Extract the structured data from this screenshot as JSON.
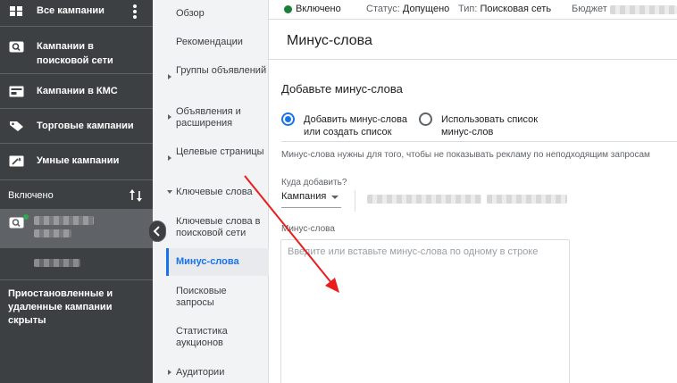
{
  "sidebar": {
    "all_campaigns": "Все кампании",
    "search_campaigns": "Кампании в поисковой сети",
    "display_campaigns": "Кампании в КМС",
    "shopping_campaigns": "Торговые кампании",
    "smart_campaigns": "Умные кампании",
    "enabled_section": "Включено",
    "hidden_note": "Приостановленные и удаленные кампании скрыты"
  },
  "nav": {
    "overview": "Обзор",
    "recommendations": "Рекомендации",
    "ad_groups": "Группы объявлений",
    "ads_extensions": "Объявления и расширения",
    "landing_pages": "Целевые страницы",
    "keywords": "Ключевые слова",
    "search_keywords": "Ключевые слова в поисковой сети",
    "negative_keywords": "Минус-слова",
    "search_terms": "Поисковые запросы",
    "auction_insights": "Статистика аукционов",
    "audiences": "Аудитории"
  },
  "topbar": {
    "enabled": "Включено",
    "status_label": "Статус:",
    "status_value": "Допущено",
    "type_label": "Тип:",
    "type_value": "Поисковая сеть",
    "budget_label": "Бюджет"
  },
  "main": {
    "title": "Минус-слова",
    "section_title": "Добавьте минус-слова",
    "option_add": "Добавить минус-слова или создать список",
    "option_use_list": "Использовать список минус-слов",
    "hint": "Минус-слова нужны для того, чтобы не показывать рекламу по неподходящим запросам",
    "where_label": "Куда добавить?",
    "where_value": "Кампания",
    "neg_label": "Минус-слова",
    "neg_placeholder": "Введите или вставьте минус-слова по одному в строке"
  },
  "colors": {
    "sidebar_bg": "#3c4043",
    "accent_blue": "#1a73e8",
    "status_green": "#188038",
    "annotation_red": "#ea1d1d"
  }
}
